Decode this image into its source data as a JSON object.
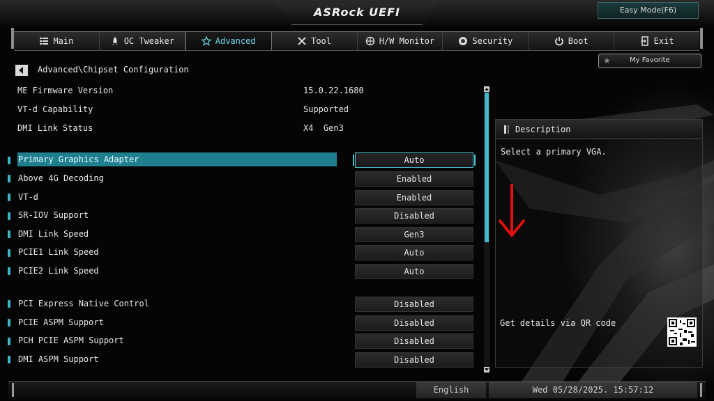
{
  "header": {
    "logo": "ASRock UEFI",
    "easy_mode": "Easy Mode(F6)",
    "my_favorite": "My Favorite"
  },
  "tabs": [
    {
      "label": "Main",
      "icon": "list-icon",
      "active": false
    },
    {
      "label": "OC Tweaker",
      "icon": "rocket-icon",
      "active": false
    },
    {
      "label": "Advanced",
      "icon": "star-icon",
      "active": true
    },
    {
      "label": "Tool",
      "icon": "tools-icon",
      "active": false
    },
    {
      "label": "H/W Monitor",
      "icon": "monitor-icon",
      "active": false
    },
    {
      "label": "Security",
      "icon": "shield-icon",
      "active": false
    },
    {
      "label": "Boot",
      "icon": "power-icon",
      "active": false
    },
    {
      "label": "Exit",
      "icon": "exit-icon",
      "active": false
    }
  ],
  "breadcrumb": "Advanced\\Chipset Configuration",
  "info": [
    {
      "label": "ME Firmware Version",
      "value": "15.0.22.1680"
    },
    {
      "label": "VT-d Capability",
      "value": "Supported"
    },
    {
      "label": "DMI Link Status",
      "value": "X4  Gen3"
    }
  ],
  "settings": [
    {
      "label": "Primary Graphics Adapter",
      "value": "Auto",
      "selected": true
    },
    {
      "label": "Above 4G Decoding",
      "value": "Enabled"
    },
    {
      "label": "VT-d",
      "value": "Enabled"
    },
    {
      "label": "SR-IOV Support",
      "value": "Disabled"
    },
    {
      "label": "DMI Link Speed",
      "value": "Gen3"
    },
    {
      "label": "PCIE1 Link Speed",
      "value": "Auto"
    },
    {
      "label": "PCIE2 Link Speed",
      "value": "Auto"
    },
    {
      "label": "PCI Express Native Control",
      "value": "Disabled"
    },
    {
      "label": "PCIE ASPM Support",
      "value": "Disabled"
    },
    {
      "label": "PCH PCIE ASPM Support",
      "value": "Disabled"
    },
    {
      "label": "DMI ASPM Support",
      "value": "Disabled"
    }
  ],
  "description": {
    "title": "Description",
    "text": "Select a primary VGA.",
    "qr_text": "Get details via QR code"
  },
  "footer": {
    "language": "English",
    "datetime": "Wed 05/28/2025. 15:57:12"
  },
  "colors": {
    "accent": "#45b6c8",
    "selected_row": "#1f7f8f",
    "annotation_arrow": "#e01010"
  }
}
